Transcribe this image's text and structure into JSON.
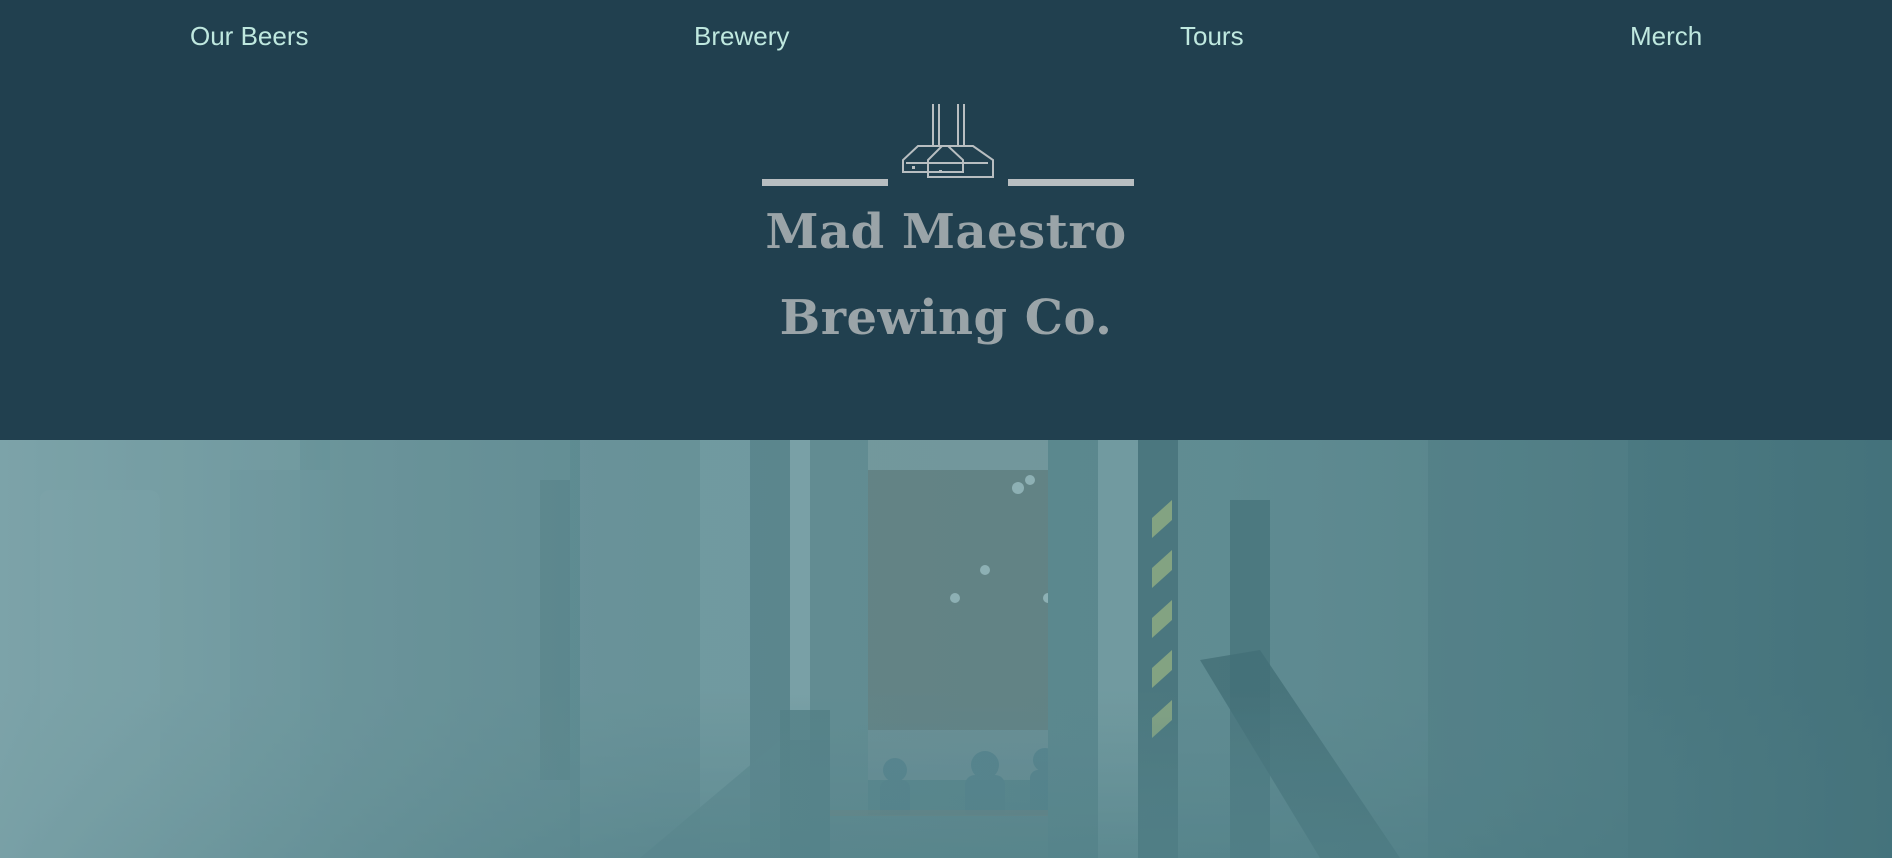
{
  "nav": {
    "items": [
      {
        "label": "Our Beers"
      },
      {
        "label": "Brewery"
      },
      {
        "label": "Tours"
      },
      {
        "label": "Merch"
      }
    ]
  },
  "brand": {
    "line1": "Mad Maestro",
    "line2": "Brewing Co.",
    "logo_icon": "brew-kettles-icon"
  },
  "hero": {
    "image_description": ""
  },
  "colors": {
    "header_bg": "#21404f",
    "nav_text": "#bfe8df",
    "brand_text": "#9aa4a8",
    "hero_tint": "#5a878d"
  }
}
